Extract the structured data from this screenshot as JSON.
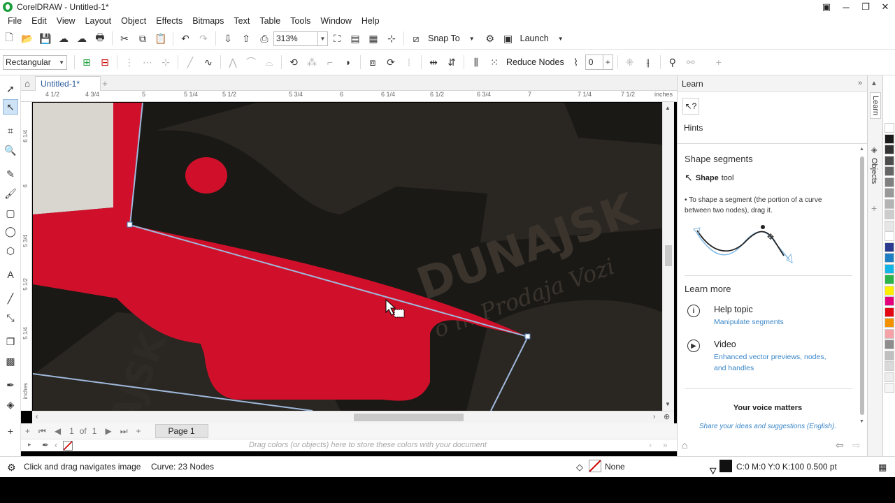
{
  "window": {
    "title": "CorelDRAW - Untitled-1*",
    "controls": [
      "▣",
      "─",
      "❐",
      "✕"
    ]
  },
  "menu": [
    "File",
    "Edit",
    "View",
    "Layout",
    "Object",
    "Effects",
    "Bitmaps",
    "Text",
    "Table",
    "Tools",
    "Window",
    "Help"
  ],
  "toolbar": {
    "zoom_value": "313%",
    "snap_to_label": "Snap To",
    "launch_label": "Launch"
  },
  "property_bar": {
    "selection_mode": "Rectangular",
    "reduce_nodes_label": "Reduce Nodes",
    "smoothness_value": "0"
  },
  "document": {
    "tab_label": "Untitled-1*"
  },
  "ruler": {
    "top_ticks": [
      "4 1/2",
      "4 3/4",
      "5",
      "5 1/4",
      "5 1/2",
      "5 3/4",
      "6",
      "6 1/4",
      "6 1/2",
      "6 3/4",
      "7",
      "7 1/4",
      "7 1/2"
    ],
    "units": "inches",
    "left_ticks": [
      "6 1/4",
      "6",
      "5 3/4",
      "5 1/2",
      "5 1/4",
      "inches"
    ]
  },
  "canvas": {
    "watermark_lines": [
      "DUNAJSK",
      "o in Prodaja Vozi",
      "NAJSK"
    ],
    "colors": {
      "background": "#1b1916",
      "red_shape": "#d0102a",
      "light_shape": "#d9d6d0",
      "outline": "#9fb8db"
    }
  },
  "page_nav": {
    "current": "1",
    "of_label": "of",
    "total": "1",
    "page_tab": "Page 1"
  },
  "color_well_hint": "Drag colors (or objects) here to store these colors with your document",
  "learn_panel": {
    "header": "Learn",
    "hints_label": "Hints",
    "section_title": "Shape segments",
    "tool_name": "Shape",
    "tool_suffix": "tool",
    "bullet": "To shape a segment (the portion of a curve between two nodes), drag it.",
    "learn_more_title": "Learn more",
    "help_topic_title": "Help topic",
    "help_topic_link": "Manipulate segments",
    "video_title": "Video",
    "video_link": "Enhanced vector previews, nodes, and handles",
    "voice_title": "Your voice matters",
    "voice_link": "Share your ideas and suggestions (English)."
  },
  "side_tabs": [
    "Learn",
    "Objects"
  ],
  "palette": [
    "#ffffff",
    "#1a1a1a",
    "#333333",
    "#4d4d4d",
    "#666666",
    "#808080",
    "#999999",
    "#b3b3b3",
    "#cccccc",
    "#e6e6e6",
    "#ffffff",
    "#2b3a8f",
    "#1f7fc4",
    "#13b4e6",
    "#2cb34a",
    "#ffed00",
    "#e4007c",
    "#e30613",
    "#f39200",
    "#f5a3a8",
    "#8d8d8d",
    "#bfbfbf",
    "#d9d9d9",
    "#ececec",
    "#f5f5f5"
  ],
  "status": {
    "hint": "Click and drag navigates image",
    "curve_info": "Curve: 23 Nodes",
    "outline_label": "None",
    "fill_info": "C:0 M:0 Y:0 K:100  0.500 pt"
  }
}
